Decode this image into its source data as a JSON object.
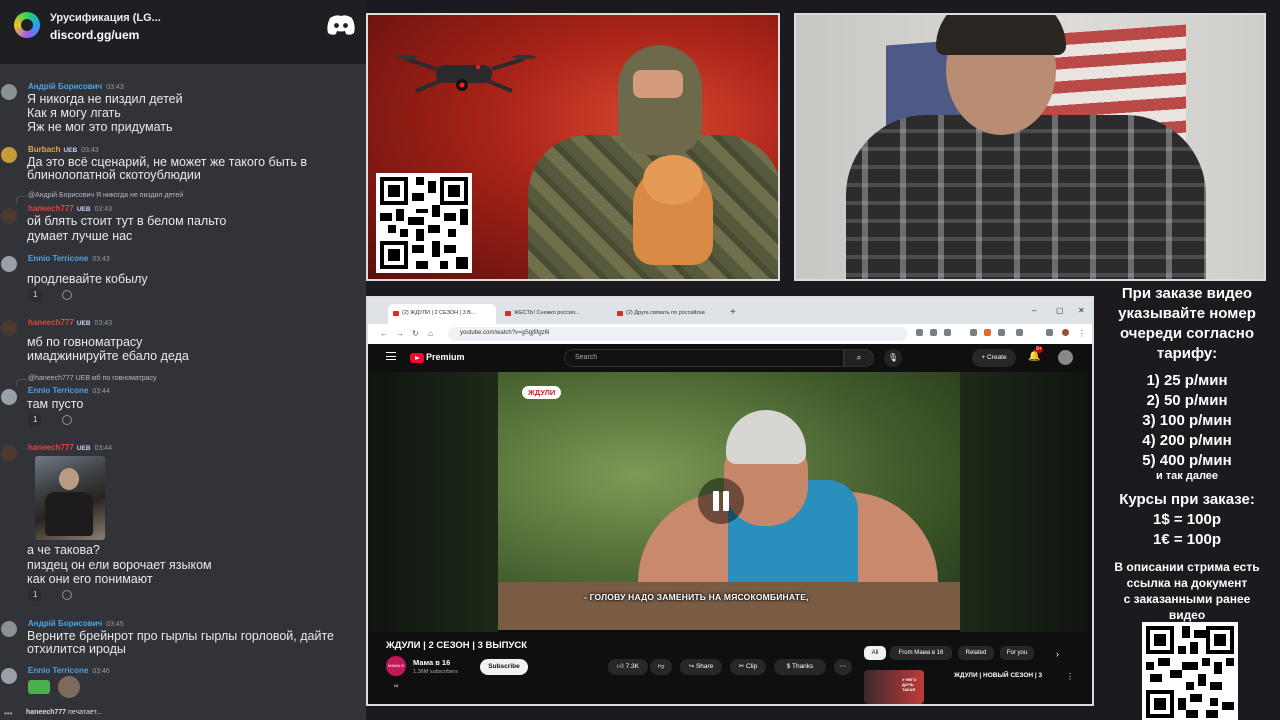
{
  "server": {
    "name": "Урусификация (LG...",
    "invite": "discord.gg/uem"
  },
  "chat": [
    {
      "user": "Андрій Борисович",
      "color": "#4fa3e6",
      "time": "03:43",
      "lines": [
        "Я никогда не пиздил детей",
        "Как я могу лгать",
        "Яж не мог это придумать"
      ]
    },
    {
      "user": "Burbach",
      "color": "#e9a54b",
      "badge": "UEB",
      "time": "03:43",
      "lines": [
        "Да это всё сценарий, не может же такого быть в",
        "блинолопатной скотоублюдии"
      ]
    },
    {
      "reply": "@Андрій Борисович Я никогда не пиздил детей",
      "user": "haneech777",
      "color": "#e0453d",
      "badge": "UEB",
      "time": "03:43",
      "lines": [
        "ой блять стоит тут в белом пальто",
        "думает лучше нас"
      ]
    },
    {
      "user": "Ennio Terricone",
      "color": "#4fa3e6",
      "time": "03:43",
      "lines": [
        "продлевайте кобылу"
      ],
      "reaction": "1"
    },
    {
      "user": "haneech777",
      "color": "#e0453d",
      "badge": "UEB",
      "time": "03:43",
      "lines": [
        "мб по говноматрасу",
        "имаджинируйте ебало деда"
      ]
    },
    {
      "reply": "@haneech777 UEB мб по говноматрасу",
      "user": "Ennio Terricone",
      "color": "#4fa3e6",
      "time": "03:44",
      "lines": [
        "там пусто"
      ],
      "reaction": "1"
    },
    {
      "user": "haneech777",
      "color": "#e0453d",
      "badge": "UEB",
      "time": "03:44",
      "lines": [
        "а че такова?",
        "пиздец он ели ворочает языком",
        "как они его понимают"
      ],
      "reaction": "1"
    },
    {
      "user": "Андрій Борисович",
      "color": "#4fa3e6",
      "time": "03:45",
      "lines": [
        "Верните брейнрот про гырлы гырлы горловой, дайте",
        "отхилится ироды"
      ]
    },
    {
      "user": "Ennio Terricone",
      "color": "#4fa3e6",
      "time": "03:46",
      "lines": []
    }
  ],
  "typing": {
    "user": "haneech777",
    "text": "печатает..."
  },
  "browser": {
    "tabs": [
      "(2) ЖДУЛИ | 2 СЕЗОН | 3 В...",
      "ЖЕСТЬ! Снежко россия...",
      "(2) Друга связать по российски"
    ],
    "url": "youtube.com/watch?v=gSgjfifgz6I"
  },
  "youtube": {
    "brand": "Premium",
    "search_placeholder": "Search",
    "create_label": "Create",
    "bell_count": "9+",
    "video_badge": "ЖДУЛИ",
    "subtitle": "- ГОЛОВУ НАДО ЗАМЕНИТЬ НА МЯСОКОМБИНАТЕ,",
    "title": "ЖДУЛИ | 2 СЕЗОН | 3 ВЫПУСК",
    "channel": "Мама в 16",
    "channel_avatar": "МАМА В 16",
    "subscribers": "1.36M subscribers",
    "subscribe": "Subscribe",
    "likes": "7.3K",
    "share": "Share",
    "clip": "Clip",
    "thanks": "Thanks",
    "chips": [
      "All",
      "From Мама в 16",
      "Related",
      "For you"
    ],
    "rec_title": "ЖДУЛИ | НОВЫЙ СЕЗОН | 3",
    "rec_thumb_text": "У НЕГО ДОЧЬ ТАКАЯ"
  },
  "info": {
    "heading": [
      "При заказе видео",
      "указывайте номер",
      "очереди согласно",
      "тарифу:"
    ],
    "rates": [
      "1) 25 р/мин",
      "2) 50 р/мин",
      "3) 100 р/мин",
      "4) 200 р/мин",
      "5) 400 р/мин"
    ],
    "etc": "и так далее",
    "courses_title": "Курсы при заказе:",
    "courses": [
      "1$ = 100р",
      "1€ = 100р"
    ],
    "desc": [
      "В описании стрима есть",
      "ссылка на документ",
      "с заказанными ранее",
      "видео"
    ]
  },
  "colors": {
    "accent": "#ff0033",
    "discord_bg": "#313338",
    "name_blue": "#4fa3e6",
    "name_red": "#e0453d"
  }
}
